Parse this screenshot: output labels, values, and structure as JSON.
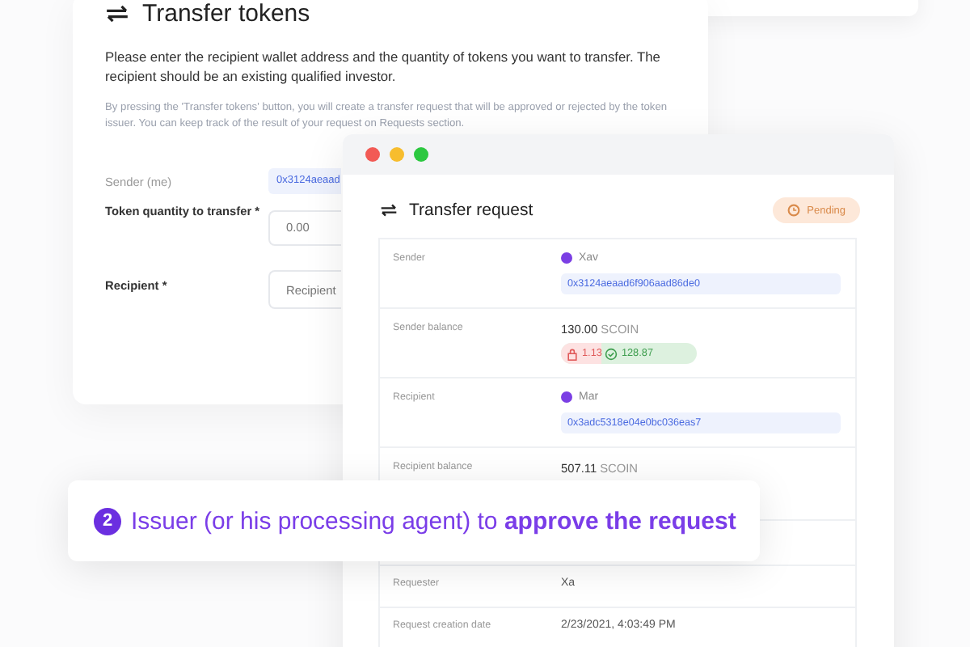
{
  "transfer_form": {
    "title": "Transfer tokens",
    "instructions": "Please enter the recipient wallet address and the quantity of tokens you want to transfer. The recipient should be an existing qualified investor.",
    "note": "By pressing the 'Transfer tokens' button, you will create a transfer request that will be approved or rejected by the token issuer. You can keep track of the result of your request on Requests section.",
    "fields": [
      {
        "label": "Sender (me)",
        "kind": "address",
        "value": "0x3124aeaad"
      },
      {
        "label": "Token quantity to transfer *",
        "kind": "input",
        "placeholder": "0.00"
      },
      {
        "label": "Recipient *",
        "kind": "input",
        "placeholder": "Recipient"
      }
    ]
  },
  "request_window": {
    "title": "Transfer request",
    "status": "Pending",
    "rows": [
      {
        "label": "Sender",
        "kind": "party",
        "name": "Xav",
        "address": "0x3124aeaad6f906aad86de0"
      },
      {
        "label": "Sender balance",
        "kind": "balance",
        "amount": "130.00",
        "unit": "SCOIN",
        "locked": "1.13",
        "available": "128.87"
      },
      {
        "label": "Recipient",
        "kind": "party",
        "name": "Mar",
        "address": "0x3adc5318e04e0bc036eas7"
      },
      {
        "label": "Recipient balance",
        "kind": "amount",
        "amount": "507.11",
        "unit": "SCOIN"
      },
      {
        "kind": "blank"
      },
      {
        "label": "Requester",
        "kind": "text",
        "value": "Xa"
      },
      {
        "label": "Request creation date",
        "kind": "text",
        "value": "2/23/2021, 4:03:49 PM"
      }
    ]
  },
  "callout": {
    "step": "2",
    "text": "Issuer (or his processing agent) to **approve the request**"
  }
}
